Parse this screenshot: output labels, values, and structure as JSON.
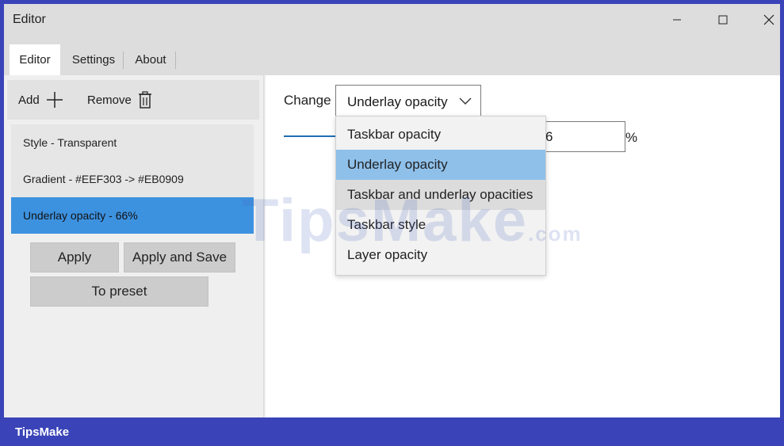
{
  "window": {
    "title": "Editor"
  },
  "tabs": [
    {
      "label": "Editor",
      "active": true
    },
    {
      "label": "Settings",
      "active": false
    },
    {
      "label": "About",
      "active": false
    }
  ],
  "toolbar": {
    "add_label": "Add",
    "remove_label": "Remove"
  },
  "list": {
    "items": [
      {
        "label": "Style - Transparent",
        "selected": false
      },
      {
        "label": "Gradient - #EEF303 -> #EB0909",
        "selected": false
      },
      {
        "label": "Underlay opacity - 66%",
        "selected": true
      }
    ]
  },
  "buttons": {
    "apply": "Apply",
    "apply_save": "Apply and Save",
    "preset": "To preset"
  },
  "main": {
    "change_label": "Change",
    "select_value": "Underlay opacity",
    "opacity_value": "6",
    "unit": "%"
  },
  "dropdown": {
    "options": [
      {
        "label": "Taskbar opacity",
        "state": "normal"
      },
      {
        "label": "Underlay opacity",
        "state": "selected"
      },
      {
        "label": "Taskbar and underlay opacities",
        "state": "hover"
      },
      {
        "label": "Taskbar style",
        "state": "normal"
      },
      {
        "label": "Layer opacity",
        "state": "normal"
      }
    ]
  },
  "watermark": {
    "main": "TipsMake",
    "suffix": ".com"
  },
  "footer": {
    "brand": "TipsMake"
  },
  "colors": {
    "accent": "#3d92e0",
    "dropdown_selected": "#8ec0ea",
    "frame": "#3a44b8"
  }
}
